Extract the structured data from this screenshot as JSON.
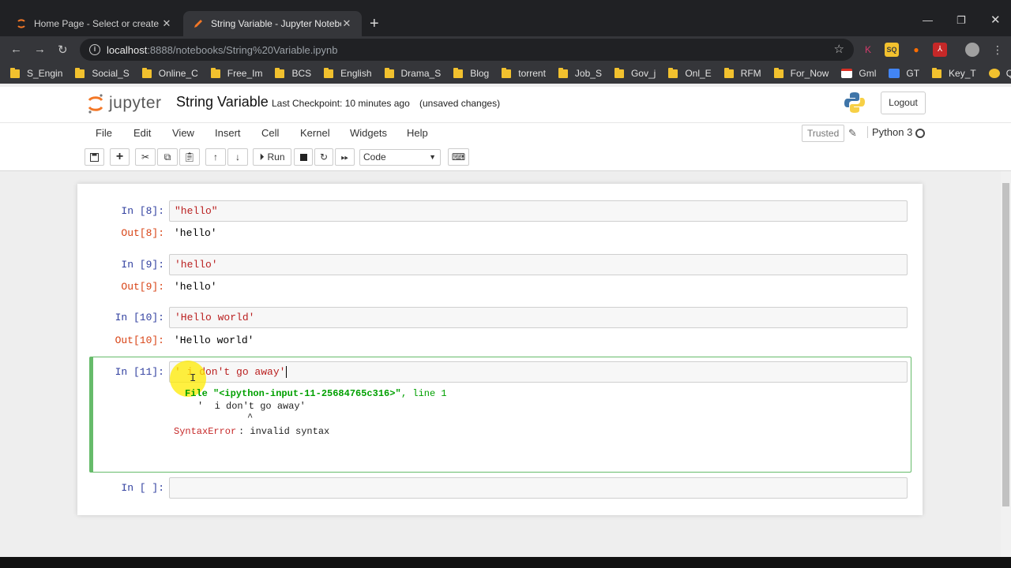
{
  "browser": {
    "tabs": [
      {
        "title": "Home Page - Select or create a n",
        "active": false
      },
      {
        "title": "String Variable - Jupyter Noteboo",
        "active": true
      }
    ],
    "url_host": "localhost",
    "url_path": ":8888/notebooks/String%20Variable.ipynb",
    "bookmarks": [
      "S_Engin",
      "Social_S",
      "Online_C",
      "Free_Im",
      "BCS",
      "English",
      "Drama_S",
      "Blog",
      "torrent",
      "Job_S",
      "Gov_j",
      "Onl_E",
      "RFM",
      "For_Now",
      "Gml",
      "GT",
      "Key_T",
      "Q"
    ],
    "extension_letters": [
      "K",
      "SQ"
    ]
  },
  "jupyter": {
    "logo_text": "jupyter",
    "notebook_name": "String Variable",
    "checkpoint": "Last Checkpoint: 10 minutes ago",
    "unsaved": "(unsaved changes)",
    "logout_label": "Logout",
    "menu": [
      "File",
      "Edit",
      "View",
      "Insert",
      "Cell",
      "Kernel",
      "Widgets",
      "Help"
    ],
    "trusted_label": "Trusted",
    "kernel_name": "Python 3",
    "run_label": "Run",
    "cell_type": "Code"
  },
  "cells": [
    {
      "in_prompt": "In [8]:",
      "input": "\"hello\"",
      "out_prompt": "Out[8]:",
      "output": "'hello'"
    },
    {
      "in_prompt": "In [9]:",
      "input": "'hello'",
      "out_prompt": "Out[9]:",
      "output": "'hello'"
    },
    {
      "in_prompt": "In [10]:",
      "input": "'Hello world'",
      "out_prompt": "Out[10]:",
      "output": "'Hello world'"
    },
    {
      "in_prompt": "In [11]:",
      "input": "' i don't go away'"
    },
    {
      "in_prompt": "In [ ]:",
      "input": ""
    }
  ],
  "error": {
    "file_label": "File",
    "file_path": "\"<ipython-input-11-25684765c316>\"",
    "line_info": ", line 1",
    "code_line": "'  i don't go away'",
    "caret": "^",
    "type": "SyntaxError",
    "message": ": invalid syntax"
  },
  "colors": {
    "prompt_in": "#303f9f",
    "prompt_out": "#d84315",
    "string": "#ba2121",
    "selected_border": "#66bb6a",
    "error_green": "#00a000"
  }
}
